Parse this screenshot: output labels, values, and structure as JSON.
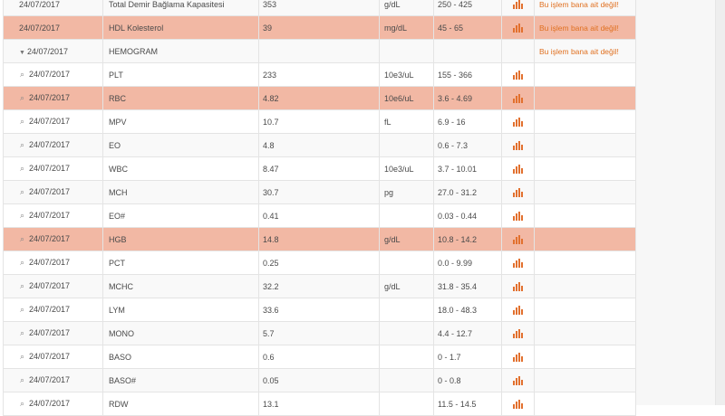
{
  "rows": [
    {
      "date": "24/07/2017",
      "name": "Total Demir Bağlama Kapasitesi",
      "value": "353",
      "unit": "g/dL",
      "ref": "250 - 425",
      "action": "Bu işlem bana ait değil!",
      "flag": false
    },
    {
      "date": "24/07/2017",
      "name": "HDL Kolesterol",
      "value": "39",
      "unit": "mg/dL",
      "ref": "45 - 65",
      "action": "Bu işlem bana ait değil!",
      "flag": true
    },
    {
      "date": "24/07/2017",
      "name": "HEMOGRAM",
      "value": "",
      "unit": "",
      "ref": "",
      "action": "Bu işlem bana ait değil!",
      "flag": false,
      "group": true
    },
    {
      "date": "24/07/2017",
      "name": "PLT",
      "value": "233",
      "unit": "10e3/uL",
      "ref": "155 - 366",
      "action": "",
      "flag": false
    },
    {
      "date": "24/07/2017",
      "name": "RBC",
      "value": "4.82",
      "unit": "10e6/uL",
      "ref": "3.6 - 4.69",
      "action": "",
      "flag": true
    },
    {
      "date": "24/07/2017",
      "name": "MPV",
      "value": "10.7",
      "unit": "fL",
      "ref": "6.9 - 16",
      "action": "",
      "flag": false
    },
    {
      "date": "24/07/2017",
      "name": "EO",
      "value": "4.8",
      "unit": "",
      "ref": "0.6 - 7.3",
      "action": "",
      "flag": false
    },
    {
      "date": "24/07/2017",
      "name": "WBC",
      "value": "8.47",
      "unit": "10e3/uL",
      "ref": "3.7 - 10.01",
      "action": "",
      "flag": false
    },
    {
      "date": "24/07/2017",
      "name": "MCH",
      "value": "30.7",
      "unit": "pg",
      "ref": "27.0 - 31.2",
      "action": "",
      "flag": false
    },
    {
      "date": "24/07/2017",
      "name": "EO#",
      "value": "0.41",
      "unit": "",
      "ref": "0.03 - 0.44",
      "action": "",
      "flag": false
    },
    {
      "date": "24/07/2017",
      "name": "HGB",
      "value": "14.8",
      "unit": "g/dL",
      "ref": "10.8 - 14.2",
      "action": "",
      "flag": true
    },
    {
      "date": "24/07/2017",
      "name": "PCT",
      "value": "0.25",
      "unit": "",
      "ref": "0.0 - 9.99",
      "action": "",
      "flag": false
    },
    {
      "date": "24/07/2017",
      "name": "MCHC",
      "value": "32.2",
      "unit": "g/dL",
      "ref": "31.8 - 35.4",
      "action": "",
      "flag": false
    },
    {
      "date": "24/07/2017",
      "name": "LYM",
      "value": "33.6",
      "unit": "",
      "ref": "18.0 - 48.3",
      "action": "",
      "flag": false
    },
    {
      "date": "24/07/2017",
      "name": "MONO",
      "value": "5.7",
      "unit": "",
      "ref": "4.4 - 12.7",
      "action": "",
      "flag": false
    },
    {
      "date": "24/07/2017",
      "name": "BASO",
      "value": "0.6",
      "unit": "",
      "ref": "0 - 1.7",
      "action": "",
      "flag": false
    },
    {
      "date": "24/07/2017",
      "name": "BASO#",
      "value": "0.05",
      "unit": "",
      "ref": "0 - 0.8",
      "action": "",
      "flag": false
    },
    {
      "date": "24/07/2017",
      "name": "RDW",
      "value": "13.1",
      "unit": "",
      "ref": "11.5 - 14.5",
      "action": "",
      "flag": false
    }
  ],
  "colors": {
    "flag_row": "#f2b8a4",
    "accent": "#e2702e",
    "action_text": "#e07020"
  },
  "icons": {
    "row_icon": "paperclip-icon",
    "chart_icon": "bar-chart-icon",
    "group_toggle": "caret-down-icon"
  }
}
